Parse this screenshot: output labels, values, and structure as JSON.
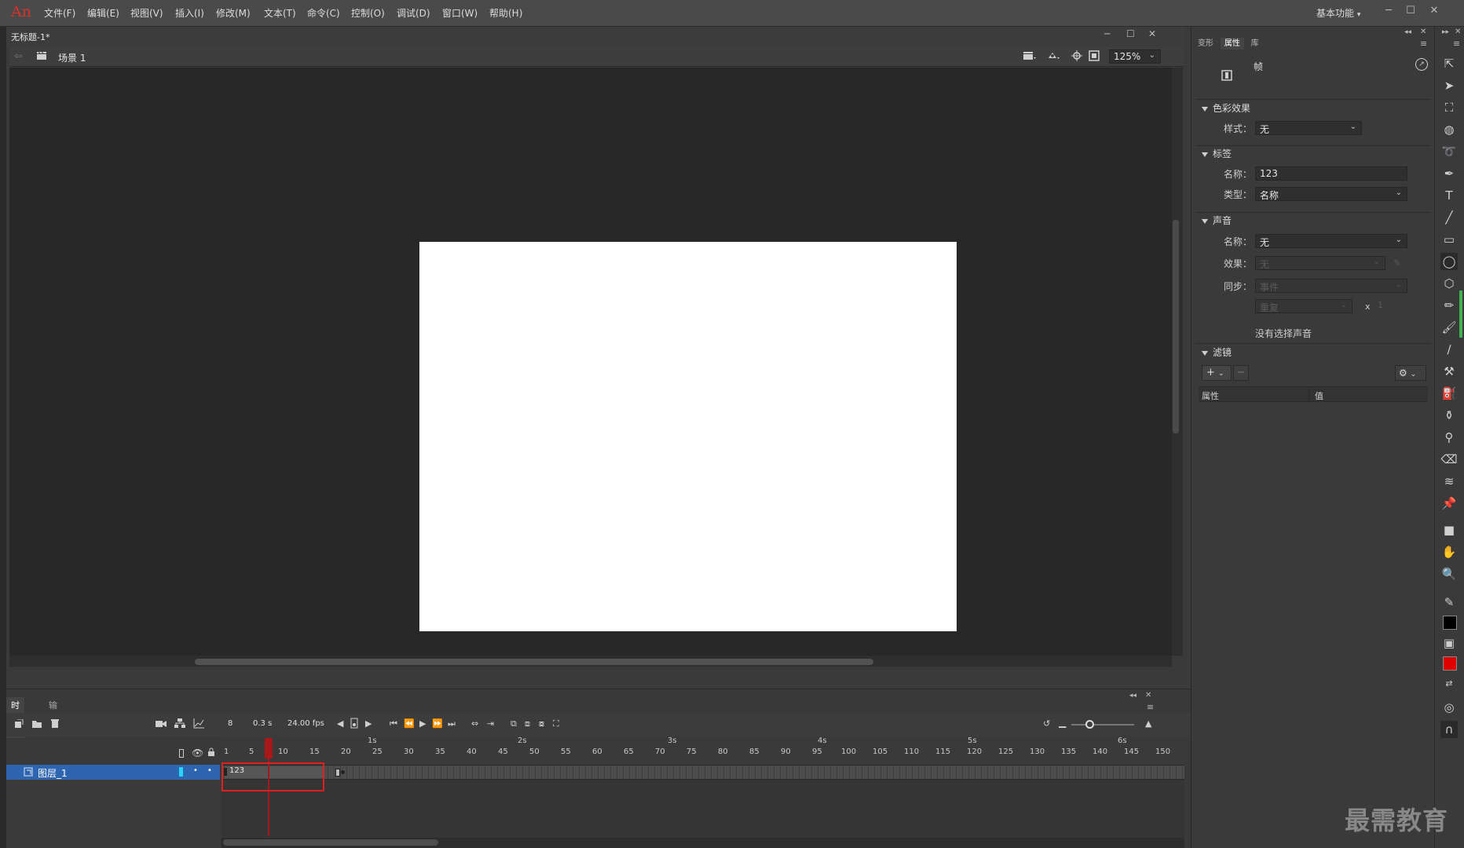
{
  "app": {
    "logo": "An",
    "menu": [
      "文件(F)",
      "编辑(E)",
      "视图(V)",
      "插入(I)",
      "修改(M)",
      "文本(T)",
      "命令(C)",
      "控制(O)",
      "调试(D)",
      "窗口(W)",
      "帮助(H)"
    ],
    "workspace": "基本功能"
  },
  "document": {
    "title": "无标题-1*",
    "scene": "场景 1",
    "zoom": "125%"
  },
  "timeline": {
    "tabs": [
      "时间轴",
      "输出"
    ],
    "current_frame": "8",
    "elapsed": "0.3 s",
    "fps": "24.00 fps",
    "layer_name": "图层_1",
    "frame_label": "123",
    "ruler_numbers": [
      "1",
      "5",
      "10",
      "15",
      "20",
      "25",
      "30",
      "35",
      "40",
      "45",
      "50",
      "55",
      "60",
      "65",
      "70",
      "75",
      "80",
      "85",
      "90",
      "95",
      "100",
      "105",
      "110",
      "115",
      "120",
      "125",
      "130",
      "135",
      "140",
      "145",
      "150"
    ],
    "ruler_seconds": [
      "1s",
      "2s",
      "3s",
      "4s",
      "5s",
      "6s"
    ]
  },
  "properties": {
    "tabs": [
      "变形",
      "属性",
      "库"
    ],
    "active_tab": "属性",
    "object_type": "帧",
    "color_effect": {
      "heading": "色彩效果",
      "style_label": "样式：",
      "style_value": "无"
    },
    "label": {
      "heading": "标签",
      "name_label": "名称：",
      "name_value": "123",
      "type_label": "类型：",
      "type_value": "名称"
    },
    "sound": {
      "heading": "声音",
      "name_label": "名称：",
      "name_value": "无",
      "effect_label": "效果：",
      "effect_value": "无",
      "sync_label": "同步：",
      "sync_value": "事件",
      "repeat_value": "重复",
      "repeat_x": "x",
      "repeat_count": "1",
      "status": "没有选择声音"
    },
    "filters": {
      "heading": "滤镜",
      "col_property": "属性",
      "col_value": "值"
    }
  },
  "watermark": "最需教育"
}
